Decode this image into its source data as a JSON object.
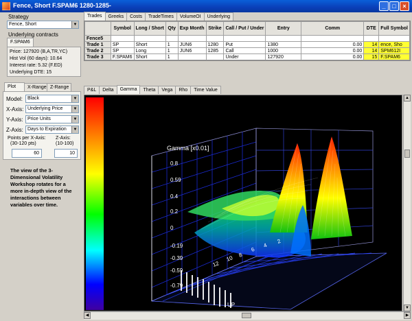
{
  "window": {
    "title": "Fence, Short F.SPAM6 1280-1285-"
  },
  "left": {
    "strategy_label": "Strategy",
    "strategy_value": "Fence, Short",
    "underlying_label": "Underlying contracts",
    "underlying_tab": "F.SPAM6",
    "info": [
      "Price: 127920 (B,A,TR,YC)",
      "Hist Vol (60 days): 10.64",
      "Interest rate: 5.32 (F.ED)",
      "Underlying DTE: 15"
    ],
    "tabs": [
      "Plot",
      "X-Range",
      "Z-Range"
    ],
    "model_label": "Model:",
    "model_value": "Black",
    "xaxis_label": "X-Axis:",
    "xaxis_value": "Underlying Price",
    "yaxis_label": "Y-Axis:",
    "yaxis_value": "Price Units",
    "zaxis_label": "Z-Axis:",
    "zaxis_value": "Days to Expiration",
    "points_label_x": "Points per X-Axis:",
    "points_range_x": "(30-120 pts)",
    "points_label_z": "Z-Axis:",
    "points_range_z": "(10-100)",
    "points_x_value": "60",
    "points_z_value": "10",
    "note": "The view of the 3-Dimensional Volatility Workshop rotates for a more in-depth view of the interactions between variables over time."
  },
  "top_tabs": [
    "Trades",
    "Greeks",
    "Costs",
    "TradeTimes",
    "VolumeOI",
    "Underlying"
  ],
  "trades": {
    "headers": [
      "",
      "Symbol",
      "Long / Short",
      "Qty",
      "Exp Month",
      "Strike",
      "Call / Put / Under",
      "Entry",
      "Comm",
      "DTE",
      "Full Symbol"
    ],
    "rows": [
      [
        "Fence5",
        "",
        "",
        "",
        "",
        "",
        "",
        "",
        "",
        "",
        ""
      ],
      [
        "Trade 1",
        "SP",
        "Short",
        "1",
        "JUN6",
        "1280",
        "Put",
        "1380",
        "0.00",
        "14",
        "ence, Sho"
      ],
      [
        "Trade 2",
        "SP",
        "Long",
        "1",
        "JUN6",
        "1285",
        "Call",
        "1000",
        "0.00",
        "14",
        "SPM612I"
      ],
      [
        "Trade 3",
        "F.SPAM6",
        "Short",
        "1",
        "",
        "",
        "Under",
        "127920",
        "0.00",
        "15",
        "F.SPAM6"
      ]
    ]
  },
  "chart_tabs": [
    "P&L",
    "Delta",
    "Gamma",
    "Theta",
    "Vega",
    "Rho",
    "Time Value"
  ],
  "chart": {
    "zlabel": "Gamma [x0.01]",
    "zticks": [
      "0.8",
      "0.59",
      "0.4",
      "0.2",
      "0",
      "-0.19",
      "-0.39",
      "-0.59",
      "-0.79"
    ],
    "dte_ticks": [
      "12",
      "10",
      "8",
      "6",
      "4",
      "2"
    ],
    "price_label": "UP"
  },
  "colors": {
    "titlebar": "#0a4fc8",
    "highlight": "#ffff33"
  }
}
